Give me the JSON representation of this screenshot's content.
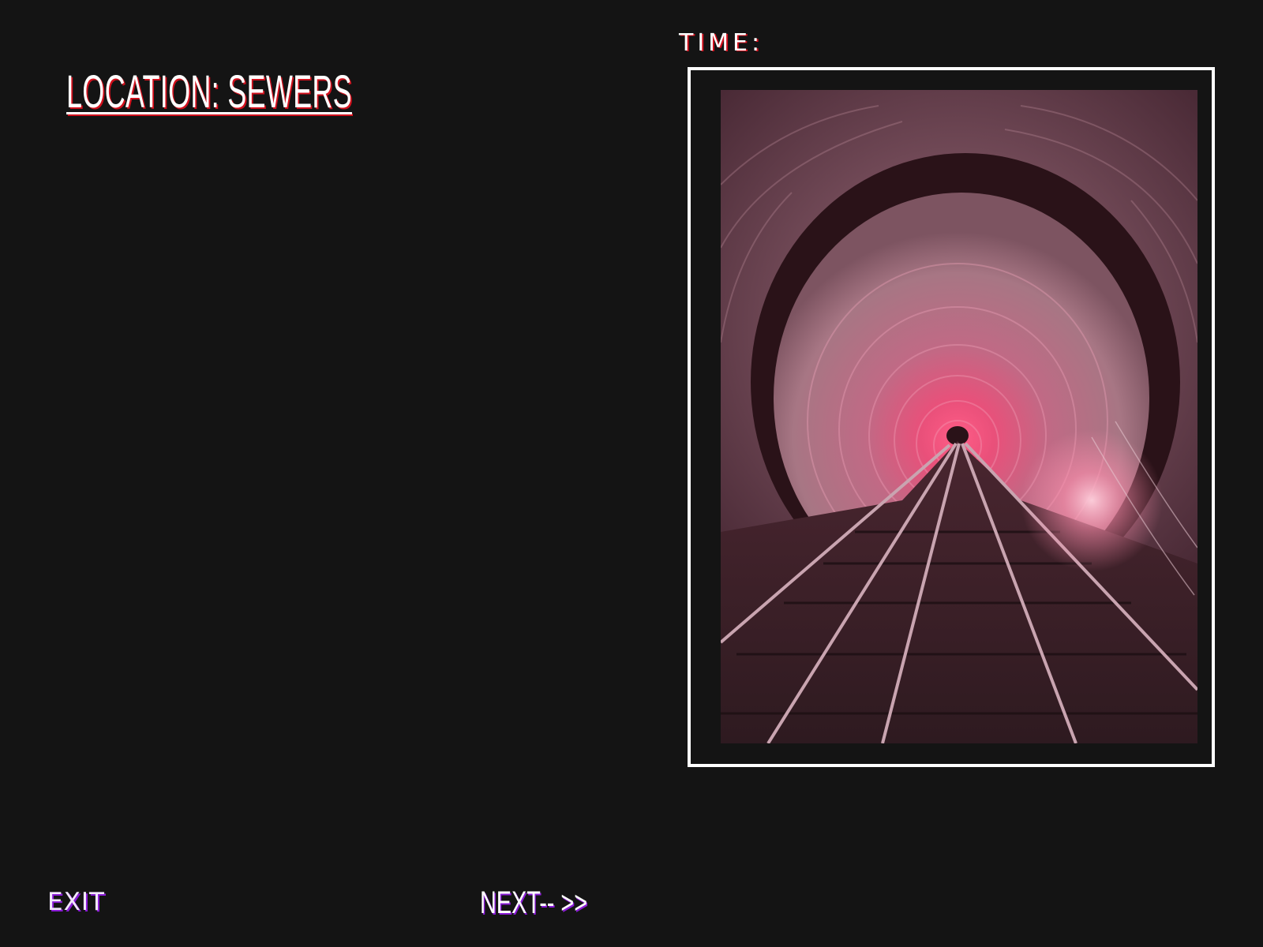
{
  "location": {
    "title": "LOCATION: SEWERS"
  },
  "timer": {
    "label": "TIME:"
  },
  "scene": {
    "subject": "tunnel-with-rail-tracks",
    "tint_color": "#d6476f",
    "frame_color": "#ffffff"
  },
  "navigation": {
    "exit_label": "EXIT",
    "next_label": "NEXT-- >>"
  },
  "colors": {
    "background": "#141414",
    "title_shadow": "#d1101c",
    "button_shadow": "#8a1bd6"
  }
}
